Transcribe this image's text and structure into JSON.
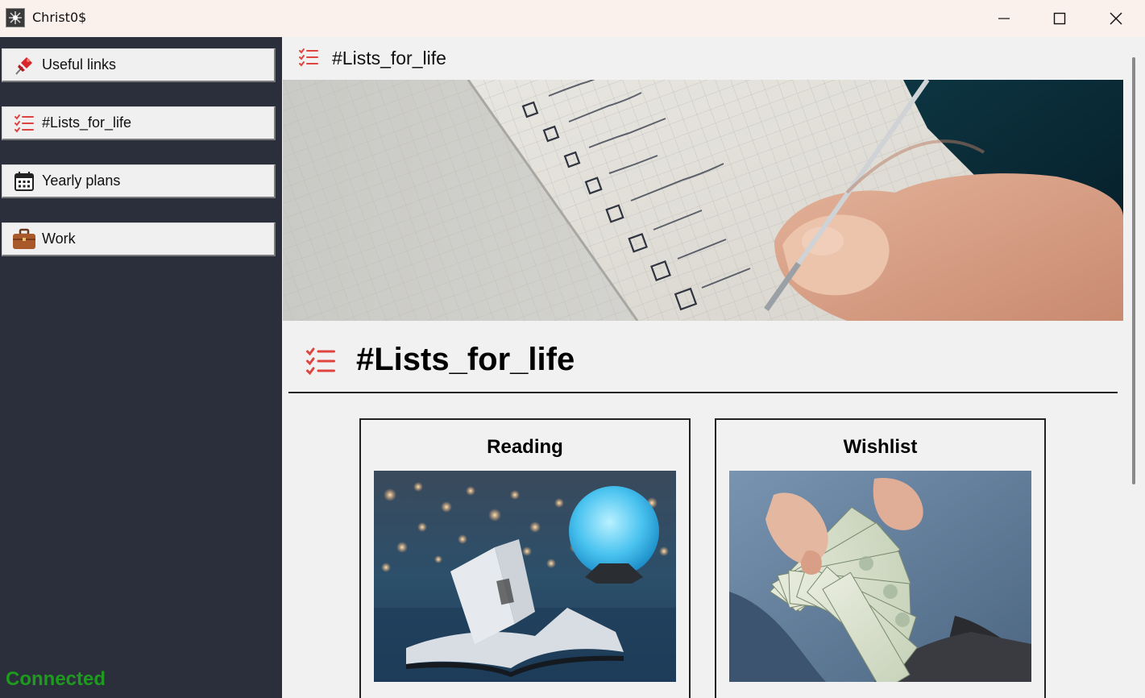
{
  "window": {
    "title": "Christ0$"
  },
  "sidebar": {
    "items": [
      {
        "label": "Useful links",
        "icon": "pushpin-icon"
      },
      {
        "label": "#Lists_for_life",
        "icon": "checklist-icon"
      },
      {
        "label": "Yearly plans",
        "icon": "calendar-icon"
      },
      {
        "label": "Work",
        "icon": "briefcase-icon"
      }
    ],
    "status": "Connected"
  },
  "page": {
    "topbar_title": "#Lists_for_life",
    "banner_image": "notebook-checklist-photo",
    "heading": "#Lists_for_life",
    "cards": [
      {
        "title": "Reading",
        "image": "open-book-moon-lamp-photo"
      },
      {
        "title": "Wishlist",
        "image": "hands-holding-dollar-bills-photo"
      }
    ]
  },
  "colors": {
    "sidebar_bg": "#2b2f3b",
    "main_bg": "#f1f1f1",
    "titlebar_bg": "#faf0ec",
    "status_green": "#1e9b1e",
    "list_icon_red": "#e0443e"
  }
}
